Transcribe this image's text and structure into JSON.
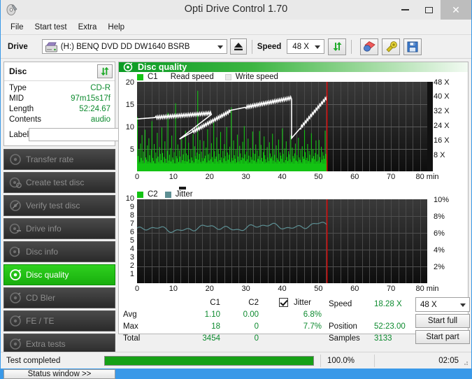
{
  "window": {
    "title": "Opti Drive Control 1.70",
    "icon": "disc-icon",
    "minimize": "minimize-icon",
    "maximize": "maximize-icon",
    "close": "✕"
  },
  "menu": {
    "items": [
      "File",
      "Start test",
      "Extra",
      "Help"
    ]
  },
  "toolbar": {
    "drive_label": "Drive",
    "drive_value": "(H:)   BENQ DVD DD DW1640 BSRB",
    "eject_icon": "eject-icon",
    "speed_label": "Speed",
    "speed_value": "48 X",
    "refresh_icon": "refresh-icon",
    "eraser_icon": "eraser-icon",
    "settings_icon": "wrench-icon",
    "save_icon": "floppy-disk-icon"
  },
  "disc": {
    "header": "Disc",
    "refresh_icon": "refresh-icon",
    "rows": [
      {
        "key": "Type",
        "value": "CD-R"
      },
      {
        "key": "MID",
        "value": "97m15s17f"
      },
      {
        "key": "Length",
        "value": "52:24.67"
      },
      {
        "key": "Contents",
        "value": "audio"
      }
    ],
    "label_key": "Label",
    "label_value": "",
    "label_placeholder": "",
    "label_button_icon": "cd-icon"
  },
  "sidebar": {
    "items": [
      {
        "label": "Transfer rate",
        "icon": "transfer-rate-icon",
        "active": false
      },
      {
        "label": "Create test disc",
        "icon": "create-disc-icon",
        "active": false
      },
      {
        "label": "Verify test disc",
        "icon": "verify-disc-icon",
        "active": false
      },
      {
        "label": "Drive info",
        "icon": "drive-info-icon",
        "active": false
      },
      {
        "label": "Disc info",
        "icon": "disc-info-icon",
        "active": false
      },
      {
        "label": "Disc quality",
        "icon": "disc-quality-icon",
        "active": true
      },
      {
        "label": "CD Bler",
        "icon": "cd-bler-icon",
        "active": false
      },
      {
        "label": "FE / TE",
        "icon": "fe-te-icon",
        "active": false
      },
      {
        "label": "Extra tests",
        "icon": "extra-tests-icon",
        "active": false
      }
    ],
    "status_window_button": "Status window >>"
  },
  "panel": {
    "title": "Disc quality",
    "icon": "disc-quality-icon"
  },
  "chart_data": [
    {
      "type": "bar",
      "name": "c1-chart",
      "title": "",
      "legend": [
        {
          "label": "C1",
          "color": "#13c313",
          "swatch": true
        },
        {
          "label": "Read speed",
          "color": "#ffffff",
          "swatch": false
        },
        {
          "label": "Write speed",
          "color": "#e8e8e8",
          "swatch": true
        }
      ],
      "xlabel": "80 min",
      "xlim": [
        0,
        80
      ],
      "xticks": [
        0,
        10,
        20,
        30,
        40,
        50,
        60,
        70,
        80
      ],
      "xticklabels": [
        "0",
        "10",
        "20",
        "30",
        "40",
        "50",
        "60",
        "70",
        "80 min"
      ],
      "ylabel": "",
      "ylim": [
        0,
        20
      ],
      "yticks": [
        5,
        10,
        15,
        20
      ],
      "yticklabels": [
        "5",
        "10",
        "15",
        "20"
      ],
      "y2lim": [
        0,
        48
      ],
      "y2ticks": [
        8,
        16,
        24,
        32,
        40,
        48
      ],
      "y2ticklabels": [
        "8 X",
        "16 X",
        "24 X",
        "32 X",
        "40 X",
        "48 X"
      ],
      "grid": true,
      "marker_position": 52.38,
      "data_end": 52.38,
      "series": [
        {
          "name": "C1",
          "color": "#13c313",
          "type": "bar",
          "values": [
            12.1,
            3.4,
            4.9,
            2.1,
            6.2,
            3.0,
            8.1,
            2.4,
            4.4,
            1.9,
            9.3,
            3.1,
            2.6,
            5.8,
            2.2,
            7.4,
            3.6,
            2.0,
            4.8,
            11.2,
            3.0,
            2.3,
            6.1,
            1.8,
            4.2,
            2.9,
            8.6,
            3.3,
            2.1,
            5.4,
            3.9,
            2.5,
            9.8,
            4.1,
            2.0,
            3.2,
            6.7,
            2.8,
            1.9,
            4.6,
            13.1,
            2.4,
            3.7,
            5.2,
            2.2,
            8.0,
            3.1,
            2.6,
            4.3,
            1.8,
            15.2,
            3.4,
            2.9,
            6.0,
            2.1,
            4.7,
            3.3,
            2.0,
            7.2,
            2.5,
            3.8,
            5.1,
            2.3,
            9.1,
            4.0,
            2.2,
            3.6,
            6.4,
            2.7,
            1.9,
            4.9,
            3.1,
            2.4,
            8.3,
            2.0,
            5.6,
            3.4,
            2.8,
            4.2,
            18.0,
            2.6,
            3.9,
            7.0,
            2.1,
            4.4,
            3.0,
            2.3,
            6.8,
            2.9,
            3.5,
            5.3,
            2.0,
            9.4,
            3.8,
            2.4,
            4.1,
            2.7,
            6.3,
            3.2,
            2.1,
            11.0,
            4.5,
            2.8,
            3.3,
            7.6,
            2.2,
            5.0,
            3.9,
            2.5,
            8.8,
            3.1,
            2.0,
            4.6,
            2.9,
            6.1,
            3.4,
            2.3,
            9.9,
            4.2,
            2.6,
            3.7,
            5.5,
            2.1,
            14.3,
            3.0,
            2.4,
            6.9,
            3.6,
            2.8,
            4.8,
            2.0,
            8.2,
            3.3,
            2.2,
            5.7,
            4.0,
            2.5,
            3.1,
            6.6,
            2.9,
            10.1,
            3.8,
            2.3,
            4.4,
            2.7,
            7.3,
            3.5,
            2.0,
            5.2,
            3.2,
            2.6,
            8.9,
            4.1,
            2.4,
            3.9,
            6.0,
            2.1,
            4.7,
            2.8,
            3.4,
            9.0,
            2.5,
            5.9,
            3.0,
            2.2,
            4.3,
            7.8,
            3.6,
            2.7,
            2.0,
            5.4,
            3.1,
            2.3,
            6.5,
            4.0,
            2.9,
            3.3,
            8.4,
            2.4,
            4.9,
            3.7,
            2.1,
            5.8,
            3.0,
            2.6,
            7.1,
            2.2,
            4.2,
            3.5,
            2.8,
            9.6,
            3.9,
            2.0,
            5.1,
            2.5,
            6.7,
            3.2,
            2.3,
            4.5,
            3.8,
            2.7,
            8.0,
            2.1,
            5.3,
            3.4,
            2.9,
            4.0,
            6.2,
            2.4,
            3.6,
            2.2,
            7.5,
            3.1,
            2.6,
            4.8,
            2.0,
            5.6,
            3.3,
            2.8,
            9.2,
            4.3,
            2.5,
            3.0,
            6.1,
            2.3,
            4.6,
            3.7,
            2.1,
            8.5,
            2.9,
            5.0,
            3.4,
            2.7,
            4.1,
            6.9,
            2.2,
            3.8,
            2.4,
            7.0,
            3.2,
            2.0,
            5.5,
            2.6,
            4.3,
            3.5,
            2.8,
            9.1,
            3.9,
            2.3
          ]
        },
        {
          "name": "Read speed",
          "color": "#ffffff",
          "type": "line",
          "unit": "X",
          "start_value": 21,
          "end_value": 40,
          "description": "Stepped rising read-speed curve from ~21X to ~40X with CAV step drops at 12, 26 and 43 min"
        }
      ]
    },
    {
      "type": "line",
      "name": "c2-jitter-chart",
      "title": "",
      "legend": [
        {
          "label": "C2",
          "color": "#13c313",
          "swatch": true
        },
        {
          "label": "Jitter",
          "color": "#5d8f93",
          "swatch": true
        }
      ],
      "xlabel": "80 min",
      "xlim": [
        0,
        80
      ],
      "xticks": [
        0,
        10,
        20,
        30,
        40,
        50,
        60,
        70,
        80
      ],
      "xticklabels": [
        "0",
        "10",
        "20",
        "30",
        "40",
        "50",
        "60",
        "70",
        "80 min"
      ],
      "ylim": [
        0,
        10
      ],
      "yticks": [
        1,
        2,
        3,
        4,
        5,
        6,
        7,
        8,
        9,
        10
      ],
      "yticklabels": [
        "1",
        "2",
        "3",
        "4",
        "5",
        "6",
        "7",
        "8",
        "9",
        "10"
      ],
      "y2lim": [
        0,
        10
      ],
      "y2ticks": [
        2,
        4,
        6,
        8,
        10
      ],
      "y2ticklabels": [
        "2%",
        "4%",
        "6%",
        "8%",
        "10%"
      ],
      "grid": true,
      "marker_position": 52.38,
      "data_end": 52.38,
      "series": [
        {
          "name": "C2",
          "color": "#13c313",
          "type": "bar",
          "values": []
        },
        {
          "name": "Jitter",
          "color": "#5d8f93",
          "type": "line",
          "unit": "%",
          "avg": 6.8,
          "max": 7.7,
          "description": "Jitter trace oscillating between ~6.2% and ~7.6%, averaging ~6.9%"
        }
      ]
    }
  ],
  "stats": {
    "columns": [
      "C1",
      "C2"
    ],
    "jitter_label": "Jitter",
    "jitter_checked": true,
    "rows": [
      {
        "label": "Avg",
        "c1": "1.10",
        "c2": "0.00",
        "jitter": "6.8%"
      },
      {
        "label": "Max",
        "c1": "18",
        "c2": "0",
        "jitter": "7.7%"
      },
      {
        "label": "Total",
        "c1": "3454",
        "c2": "0",
        "jitter": ""
      }
    ],
    "speed_label": "Speed",
    "speed_value": "18.28 X",
    "position_label": "Position",
    "position_value": "52:23.00",
    "samples_label": "Samples",
    "samples_value": "3133",
    "speed_select": "48 X",
    "start_full_button": "Start full",
    "start_part_button": "Start part"
  },
  "statusbar": {
    "message": "Test completed",
    "progress_percent": 100.0,
    "progress_text": "100.0%",
    "elapsed": "02:05"
  },
  "colors": {
    "accent_green": "#0c8a2e",
    "chart_green": "#13c313",
    "jitter_teal": "#5d8f93",
    "marker_red": "#e00000",
    "plot_bg": "#1c1c1c",
    "active_nav": "#1fc40f"
  }
}
